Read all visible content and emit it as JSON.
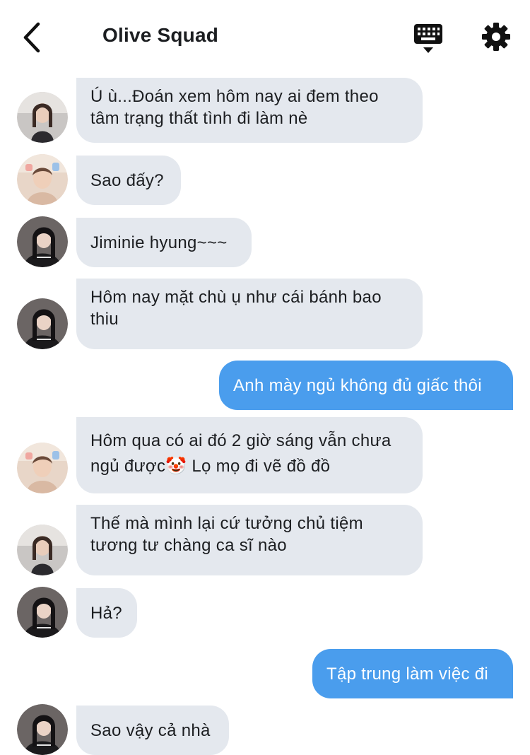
{
  "header": {
    "title": "Olive Squad",
    "back_icon": "chevron-left-icon",
    "keyboard_icon": "keyboard-icon",
    "settings_icon": "gear-icon"
  },
  "colors": {
    "incoming_bubble": "#e4e8ee",
    "outgoing_bubble": "#4a9ded",
    "outgoing_text": "#ffffff",
    "text": "#1c1e21"
  },
  "messages": [
    {
      "side": "in",
      "avatar": "avatar-girl-light",
      "lines": [
        "Ú ù...Đoán xem hôm nay ai đem theo",
        "tâm trạng thất tình đi làm nè"
      ]
    },
    {
      "side": "in",
      "avatar": "avatar-boy",
      "lines": [
        "Sao đấy?"
      ]
    },
    {
      "side": "in",
      "avatar": "avatar-girl-dark",
      "lines": [
        "Jiminie hyung~~~"
      ]
    },
    {
      "side": "in",
      "avatar": "avatar-girl-dark",
      "lines": [
        "Hôm nay mặt chù ụ như cái bánh bao",
        "thiu"
      ]
    },
    {
      "side": "out",
      "lines": [
        "Anh mày ngủ không đủ giấc thôi"
      ]
    },
    {
      "side": "in",
      "avatar": "avatar-boy",
      "lines": [
        "Hôm qua có ai đó 2 giờ sáng vẫn chưa",
        "ngủ được🤡 Lọ mọ đi vẽ đồ đồ"
      ]
    },
    {
      "side": "in",
      "avatar": "avatar-girl-light",
      "lines": [
        "Thế mà mình lại cứ tưởng chủ tiệm",
        "tương tư chàng ca sĩ nào"
      ]
    },
    {
      "side": "in",
      "avatar": "avatar-girl-dark",
      "lines": [
        "Hả?"
      ]
    },
    {
      "side": "out",
      "lines": [
        "Tập trung làm việc đi"
      ]
    },
    {
      "side": "in",
      "avatar": "avatar-girl-dark",
      "lines": [
        "Sao vậy cả nhà"
      ]
    }
  ]
}
